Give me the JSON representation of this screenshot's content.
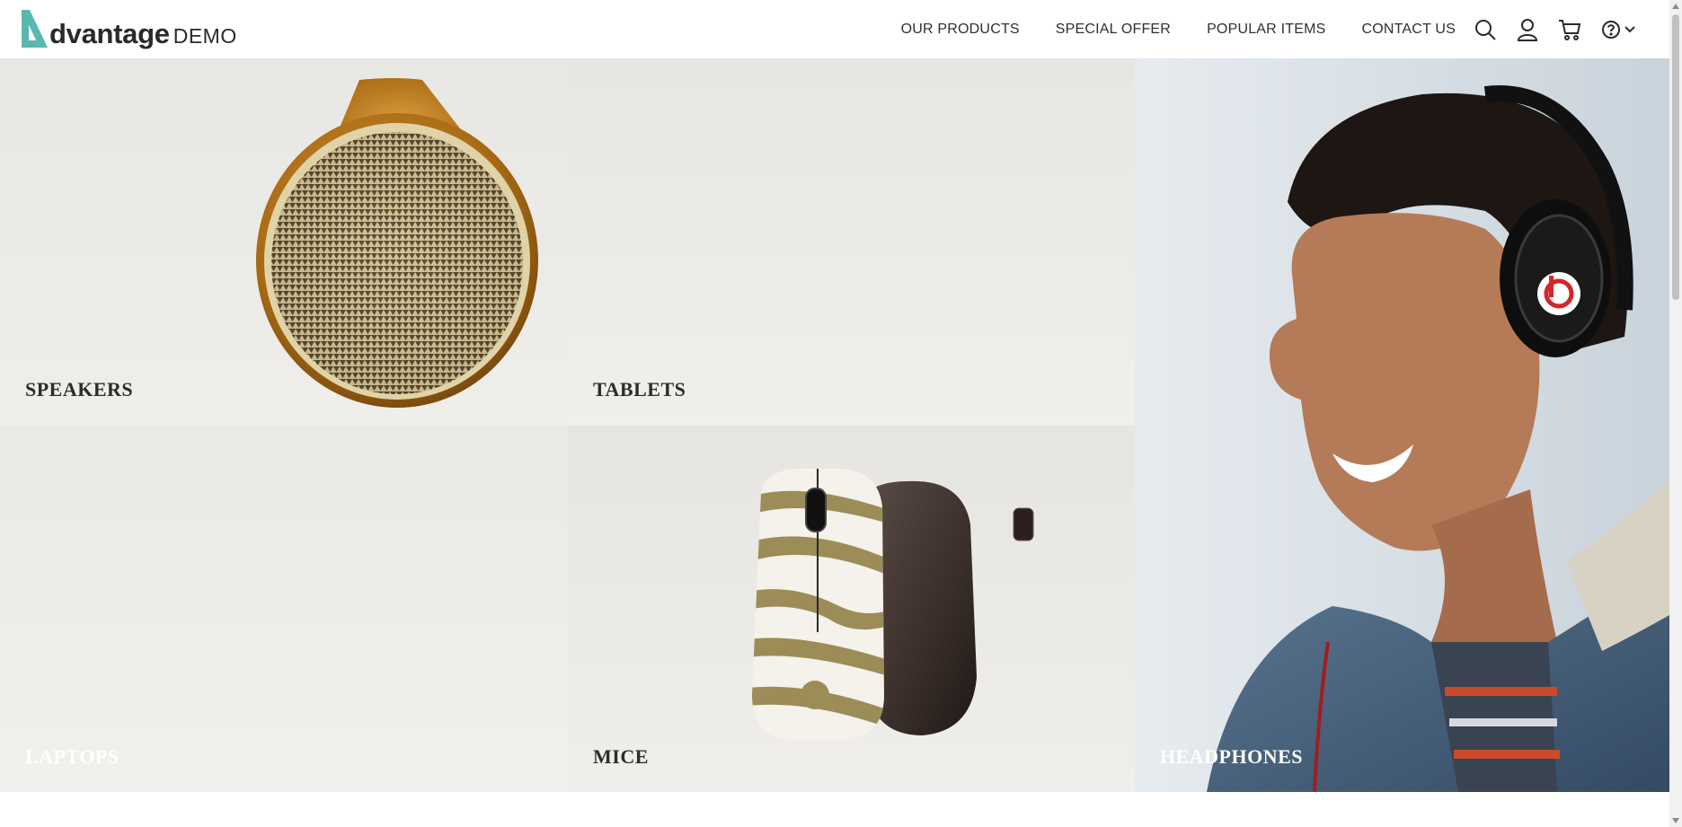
{
  "brand": {
    "logo_word": "dvantage",
    "logo_suffix": "DEMO",
    "accent_color": "#5bb7b0"
  },
  "nav": {
    "items": [
      {
        "label": "OUR PRODUCTS"
      },
      {
        "label": "SPECIAL OFFER"
      },
      {
        "label": "POPULAR ITEMS"
      },
      {
        "label": "CONTACT US"
      }
    ]
  },
  "header_icons": [
    "search-icon",
    "user-icon",
    "cart-icon",
    "help-icon",
    "chevron-down-icon"
  ],
  "categories": [
    {
      "label": "SPEAKERS",
      "label_color": "#2c2c2c"
    },
    {
      "label": "TABLETS",
      "label_color": "#2c2c2c"
    },
    {
      "label": "LAPTOPS",
      "label_color": "#ffffff"
    },
    {
      "label": "MICE",
      "label_color": "#2c2c2c"
    },
    {
      "label": "HEADPHONES",
      "label_color": "#ffffff"
    }
  ]
}
